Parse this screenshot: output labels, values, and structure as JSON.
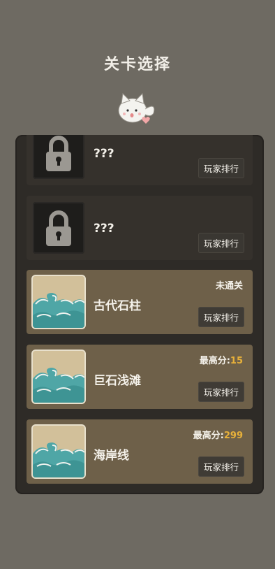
{
  "header": {
    "title": "关卡选择"
  },
  "levels": [
    {
      "name": "???",
      "locked": true,
      "rank_label": "玩家排行"
    },
    {
      "name": "???",
      "locked": true,
      "rank_label": "玩家排行"
    },
    {
      "name": "古代石柱",
      "locked": false,
      "status": "未通关",
      "rank_label": "玩家排行"
    },
    {
      "name": "巨石浅滩",
      "locked": false,
      "score_label": "最高分:",
      "score_value": "15",
      "rank_label": "玩家排行"
    },
    {
      "name": "海岸线",
      "locked": false,
      "score_label": "最高分:",
      "score_value": "299",
      "rank_label": "玩家排行"
    }
  ],
  "icons": {
    "lock": "lock-icon",
    "wave": "wave-icon",
    "mascot": "cat-mascot-icon",
    "heart": "heart-icon"
  },
  "colors": {
    "background": "#6e6a62",
    "panel": "#2e2b27",
    "open_card": "#6e6049",
    "locked_card": "#35312c",
    "score_highlight": "#e8b13a",
    "sea": "#4fa6a6"
  }
}
